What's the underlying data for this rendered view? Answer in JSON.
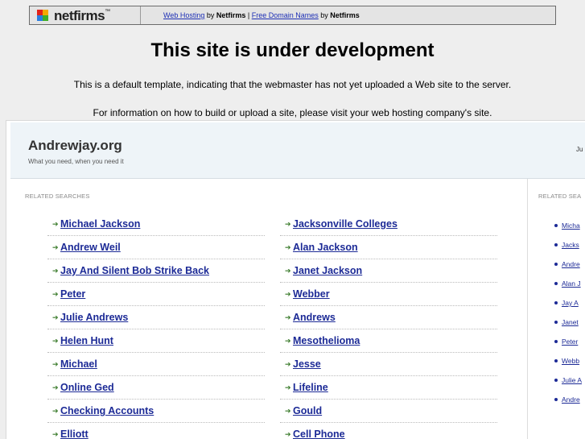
{
  "netfirms_bar": {
    "logo_text": "netfirms",
    "trademark": "™",
    "link1": "Web Hosting",
    "by1": " by ",
    "brand1": "Netfirms",
    "sep": " | ",
    "link2": "Free Domain Names",
    "by2": " by ",
    "brand2": "Netfirms",
    "logo_colors": [
      "#e2231a",
      "#f5a800",
      "#2a7de1",
      "#3fae29"
    ]
  },
  "headline": "This site is under development",
  "line1": "This is a default template, indicating that the webmaster has not yet uploaded a Web site to the server.",
  "line2": "For information on how to build or upload a site, please visit your web hosting company's site.",
  "site": {
    "title": "Andrewjay.org",
    "tagline": "What you need, when you need it",
    "header_right": "Ju"
  },
  "related_label": "RELATED SEARCHES",
  "side_related_label": "RELATED SEA",
  "left_links": [
    "Michael Jackson",
    "Andrew Weil",
    "Jay And Silent Bob Strike Back",
    "Peter",
    "Julie Andrews",
    "Helen Hunt",
    "Michael",
    "Online Ged",
    "Checking Accounts",
    "Elliott"
  ],
  "right_links": [
    "Jacksonville Colleges",
    "Alan Jackson",
    "Janet Jackson",
    "Webber",
    "Andrews",
    "Mesothelioma",
    "Jesse",
    "Lifeline",
    "Gould",
    "Cell Phone"
  ],
  "side_links": [
    "Micha",
    "Jacks",
    "Andre",
    "Alan J",
    "Jay A",
    "Janet",
    "Peter",
    "Webb",
    "Julie A",
    "Andre"
  ],
  "arrow_glyph": "➔"
}
